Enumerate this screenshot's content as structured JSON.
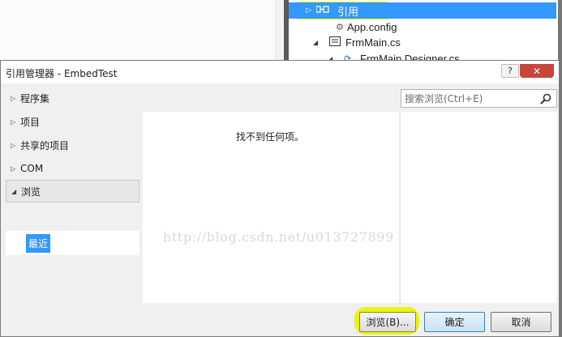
{
  "solution_tree": {
    "references": "引用",
    "app_config": "App.config",
    "frm_main": "FrmMain.cs",
    "frm_designer": "FrmMain.Designer.cs"
  },
  "dialog": {
    "title": "引用管理器 - EmbedTest",
    "help_label": "?",
    "close_label": "✕"
  },
  "nav": {
    "items": [
      {
        "label": "程序集",
        "expanded": false
      },
      {
        "label": "项目",
        "expanded": false
      },
      {
        "label": "共享的项目",
        "expanded": false
      },
      {
        "label": "COM",
        "expanded": false
      },
      {
        "label": "浏览",
        "expanded": true
      }
    ],
    "sub_item": "最近"
  },
  "search": {
    "placeholder": "搜索浏览(Ctrl+E)"
  },
  "content": {
    "empty_message": "找不到任何项。"
  },
  "watermark": "http://blog.csdn.net/u013727899",
  "buttons": {
    "browse": "浏览(B)...",
    "ok": "确定",
    "cancel": "取消"
  },
  "colors": {
    "selection": "#3399ff",
    "highlight": "#e8f60a",
    "close": "#c7453b"
  }
}
